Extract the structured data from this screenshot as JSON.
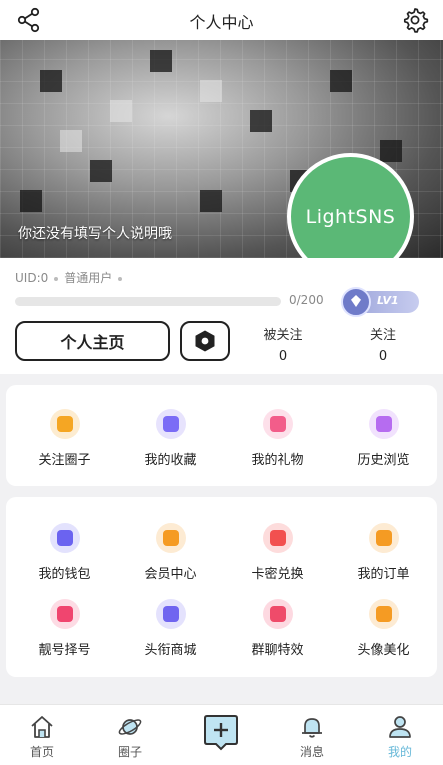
{
  "header": {
    "title": "个人中心",
    "share_icon": "share-icon",
    "settings_icon": "gear-icon"
  },
  "profile": {
    "description": "你还没有填写个人说明哦",
    "avatar_text": "LightSNS",
    "avatar_color": "#5bb876",
    "uid": "UID:0",
    "role": "普通用户",
    "exp_text": "0/200",
    "level": "LV1",
    "progress_fraction": 0,
    "home_button": "个人主页",
    "followers_label": "被关注",
    "followers_count": "0",
    "following_label": "关注",
    "following_count": "0"
  },
  "quick": [
    {
      "label": "关注圈子",
      "icon": "bookmark-icon",
      "color": "#f5a623",
      "bg": "#fdecd0"
    },
    {
      "label": "我的收藏",
      "icon": "box-icon",
      "color": "#7b6cf6",
      "bg": "#e7e3fd"
    },
    {
      "label": "我的礼物",
      "icon": "gift-icon",
      "color": "#f25d8a",
      "bg": "#fde0ea"
    },
    {
      "label": "历史浏览",
      "icon": "clock-icon",
      "color": "#b66cf0",
      "bg": "#f1e2fd"
    }
  ],
  "services": [
    {
      "label": "我的钱包",
      "icon": "wallet-icon",
      "color": "#6b63f0",
      "bg": "#e3e2fd"
    },
    {
      "label": "会员中心",
      "icon": "crown-icon",
      "color": "#f59b23",
      "bg": "#fdebd3"
    },
    {
      "label": "卡密兑换",
      "icon": "coupon-icon",
      "color": "#f2504f",
      "bg": "#fddcdc"
    },
    {
      "label": "我的订单",
      "icon": "cart-icon",
      "color": "#f59b23",
      "bg": "#fdebd3"
    },
    {
      "label": "靓号择号",
      "icon": "tag-icon",
      "color": "#f0456f",
      "bg": "#fddbe4"
    },
    {
      "label": "头衔商城",
      "icon": "medal-icon",
      "color": "#7065f0",
      "bg": "#e4e2fd"
    },
    {
      "label": "群聊特效",
      "icon": "palette-icon",
      "color": "#ef4b6a",
      "bg": "#fdd9e1"
    },
    {
      "label": "头像美化",
      "icon": "bear-icon",
      "color": "#f59b23",
      "bg": "#fdebd3"
    }
  ],
  "tabs": [
    {
      "label": "首页",
      "icon": "home-icon"
    },
    {
      "label": "圈子",
      "icon": "planet-icon"
    },
    {
      "label": "",
      "icon": "add-icon"
    },
    {
      "label": "消息",
      "icon": "bell-icon"
    },
    {
      "label": "我的",
      "icon": "user-icon"
    }
  ],
  "active_tab": "我的",
  "accent_color": "#66b8d8"
}
